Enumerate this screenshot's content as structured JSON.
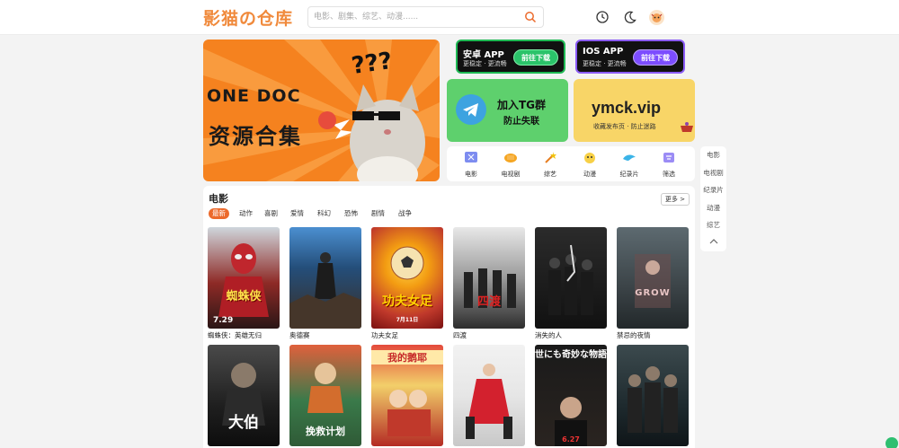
{
  "header": {
    "logo": "影猫の仓库",
    "search_placeholder": "电影、剧集、综艺、动漫......",
    "icons": [
      "search-icon",
      "history-icon",
      "moon-icon",
      "avatar"
    ]
  },
  "banner": {
    "line1": "ONE DOC",
    "line2": "资源合集",
    "question": "???"
  },
  "apps": {
    "android": {
      "title": "安卓 APP",
      "sub": "更稳定 · 更流畅",
      "button": "前往下载"
    },
    "ios": {
      "title": "IOS APP",
      "sub": "更稳定 · 更流畅",
      "button": "前往下载"
    }
  },
  "tg": {
    "title": "加入TG群",
    "sub": "防止失联"
  },
  "site": {
    "title": "ymck.vip",
    "sub": "收藏发布页 · 防止迷路"
  },
  "categories": [
    {
      "label": "电影",
      "icon": "movie-icon"
    },
    {
      "label": "电视剧",
      "icon": "tv-icon"
    },
    {
      "label": "综艺",
      "icon": "variety-icon"
    },
    {
      "label": "动漫",
      "icon": "anime-icon"
    },
    {
      "label": "纪录片",
      "icon": "documentary-icon"
    },
    {
      "label": "筛选",
      "icon": "filter-icon"
    }
  ],
  "sidenav": [
    "电影",
    "电视剧",
    "纪录片",
    "动漫",
    "综艺"
  ],
  "section": {
    "title": "电影",
    "more": "更多 >",
    "filters": [
      "最新",
      "动作",
      "喜剧",
      "爱情",
      "科幻",
      "恐怖",
      "剧情",
      "战争"
    ],
    "movies": [
      {
        "title": "蜘蛛侠：英雄无归",
        "poster_text": "蜘蛛侠",
        "poster_sub": "7.29"
      },
      {
        "title": "奥德赛",
        "poster_text": "",
        "poster_sub": ""
      },
      {
        "title": "功夫女足",
        "poster_text": "功夫女足",
        "poster_sub": "7月11日"
      },
      {
        "title": "四渡",
        "poster_text": "四渡",
        "poster_sub": ""
      },
      {
        "title": "消失的人",
        "poster_text": "",
        "poster_sub": ""
      },
      {
        "title": "禁忌的夜情",
        "poster_text": "GROW",
        "poster_sub": ""
      },
      {
        "title": "",
        "poster_text": "大伯",
        "poster_sub": ""
      },
      {
        "title": "",
        "poster_text": "挽救计划",
        "poster_sub": ""
      },
      {
        "title": "",
        "poster_text": "我的鹅耶",
        "poster_sub": ""
      },
      {
        "title": "",
        "poster_text": "",
        "poster_sub": ""
      },
      {
        "title": "",
        "poster_text": "世にも奇妙な物語",
        "poster_sub": "6.27"
      },
      {
        "title": "",
        "poster_text": "",
        "poster_sub": ""
      }
    ]
  },
  "colors": {
    "accent": "#ec6a2c",
    "logo": "#f08a3c",
    "banner": "#f5821f",
    "tg": "#5ed06d",
    "site": "#f8d567"
  }
}
